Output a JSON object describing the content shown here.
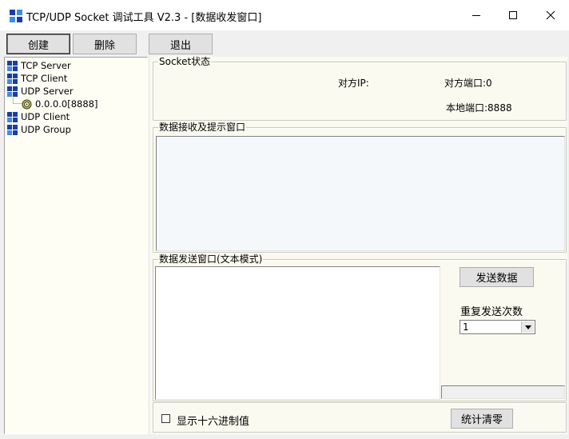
{
  "window": {
    "title": "TCP/UDP Socket 调试工具 V2.3  - [数据收发窗口]"
  },
  "toolbar": {
    "create_label": "创建",
    "delete_label": "删除",
    "exit_label": "退出"
  },
  "tree": {
    "items": [
      {
        "label": "TCP Server",
        "icon": "grid-icon"
      },
      {
        "label": "TCP Client",
        "icon": "grid-icon"
      },
      {
        "label": "UDP Server",
        "icon": "grid-icon"
      },
      {
        "label": "0.0.0.0[8888]",
        "icon": "socket-ring-icon"
      },
      {
        "label": "UDP Client",
        "icon": "grid-icon"
      },
      {
        "label": "UDP Group",
        "icon": "grid-icon"
      }
    ]
  },
  "socket_status": {
    "title": "Socket状态",
    "peer_ip_label": "对方IP:",
    "peer_port_label": "对方端口:0",
    "local_port_label": "本地端口:8888"
  },
  "receive": {
    "title": "数据接收及提示窗口",
    "content": ""
  },
  "send": {
    "title": "数据发送窗口(文本模式)",
    "content": "",
    "send_button_label": "发送数据",
    "repeat_label": "重复发送次数",
    "repeat_value": "1",
    "status_text": ""
  },
  "footer": {
    "hex_label": "显示十六进制值",
    "hex_checked": false,
    "clear_stats_label": "统计清零"
  },
  "colors": {
    "icon_blue": "#1a3ea8",
    "icon_light": "#3c8cf0",
    "tree_bg": "#fffef5",
    "receive_bg": "#f5f8fb",
    "panel_bg": "#fbfaf0"
  }
}
